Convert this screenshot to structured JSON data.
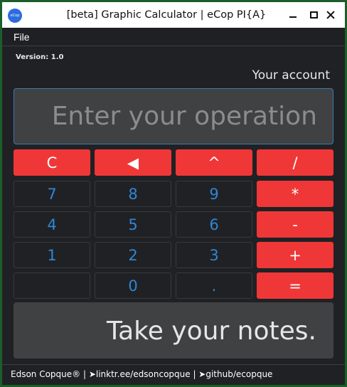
{
  "window": {
    "title": "[beta] Graphic Calculator | eCop PI{A}",
    "logo_text": "eCop Tools"
  },
  "menu": {
    "file": "File"
  },
  "version": "Version: 1.0",
  "account": "Your account",
  "operation": {
    "placeholder": "Enter your operation",
    "value": ""
  },
  "keys": {
    "clear": "C",
    "backspace": "◀",
    "power": "^",
    "divide": "/",
    "seven": "7",
    "eight": "8",
    "nine": "9",
    "multiply": "*",
    "four": "4",
    "five": "5",
    "six": "6",
    "minus": "-",
    "one": "1",
    "two": "2",
    "three": "3",
    "plus": "+",
    "blank": "",
    "zero": "0",
    "dot": ".",
    "equals": "="
  },
  "notes": "Take your notes.",
  "footer": "Edson Copque® | ➤linktr.ee/edsoncopque | ➤github/ecopque",
  "colors": {
    "operator_key": "#f03738",
    "number_text": "#2f86d6",
    "background": "#202124",
    "panel": "#3f4143"
  }
}
